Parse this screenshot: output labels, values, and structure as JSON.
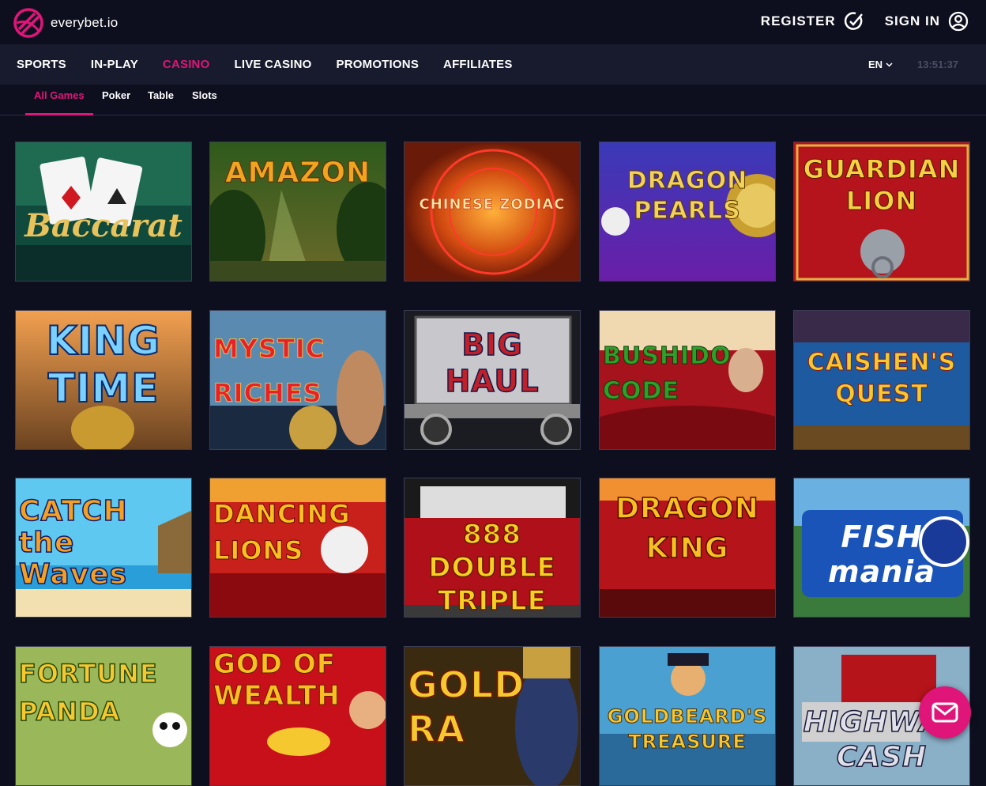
{
  "brand": {
    "name": "everybet.io",
    "logo_icon": "everybet-logo-icon"
  },
  "auth": {
    "register_label": "REGISTER",
    "register_icon": "register-check-icon",
    "signin_label": "SIGN IN",
    "signin_icon": "user-circle-icon"
  },
  "nav": {
    "items": [
      {
        "label": "SPORTS"
      },
      {
        "label": "IN-PLAY"
      },
      {
        "label": "CASINO",
        "active": true
      },
      {
        "label": "LIVE CASINO"
      },
      {
        "label": "PROMOTIONS"
      },
      {
        "label": "AFFILIATES"
      }
    ],
    "language": "EN",
    "clock": "13:51:37"
  },
  "subnav": {
    "tabs": [
      {
        "label": "All Games",
        "active": true
      },
      {
        "label": "Poker"
      },
      {
        "label": "Table"
      },
      {
        "label": "Slots"
      }
    ]
  },
  "games": [
    {
      "title": "Baccarat",
      "art_text": "Baccarat"
    },
    {
      "title": "Amazon",
      "art_text": "AMAZON"
    },
    {
      "title": "Chinese Zodiac",
      "art_text": "CHINESE ZODIAC"
    },
    {
      "title": "Dragon Pearls",
      "art_text": "DRAGON PEARLS"
    },
    {
      "title": "Guardian Lion",
      "art_text": "GUARDIAN LION"
    },
    {
      "title": "King of Time",
      "art_text": "KING TIME"
    },
    {
      "title": "Mystic Riches",
      "art_text": "MYSTIC RICHES"
    },
    {
      "title": "Big Haul",
      "art_text": "BIG HAUL"
    },
    {
      "title": "Bushido Code",
      "art_text": "BUSHIDO CODE"
    },
    {
      "title": "Caishen's Quest",
      "art_text": "CAISHEN'S QUEST"
    },
    {
      "title": "Catch the Waves",
      "art_text": "CATCH the Waves"
    },
    {
      "title": "Dancing Lions",
      "art_text": "DANCING LIONS"
    },
    {
      "title": "888 Double Triple",
      "art_text": "888 DOUBLE TRIPLE"
    },
    {
      "title": "Dragon King",
      "art_text": "DRAGON KING"
    },
    {
      "title": "Fish Mania",
      "art_text": "FISH mania"
    },
    {
      "title": "Fortune Panda",
      "art_text": "FORTUNE PANDA"
    },
    {
      "title": "God of Wealth",
      "art_text": "GOD OF WEALTH"
    },
    {
      "title": "Gold Ra",
      "art_text": "GOLD RA"
    },
    {
      "title": "Goldbeard's Treasure",
      "art_text": "GOLDBEARD'S TREASURE"
    },
    {
      "title": "Highway Cash",
      "art_text": "HIGHWAY CASH"
    }
  ],
  "chat": {
    "icon": "mail-icon"
  },
  "colors": {
    "accent": "#e0157a",
    "background": "#0d0f1e",
    "navbar": "#181b2d"
  }
}
